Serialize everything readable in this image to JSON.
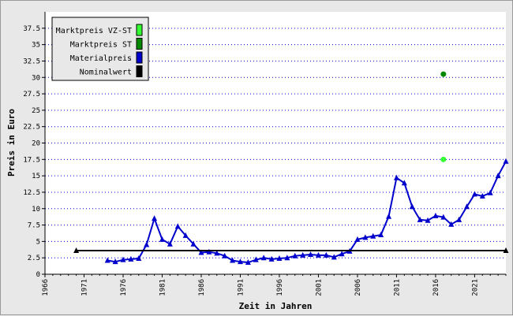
{
  "chart_data": {
    "type": "line",
    "title": "",
    "xlabel": "Zeit in Jahren",
    "ylabel": "Preis in Euro",
    "xlim": [
      1966,
      2025
    ],
    "ylim": [
      0,
      40
    ],
    "x_ticks": [
      "1966",
      "1971",
      "1976",
      "1981",
      "1986",
      "1991",
      "1996",
      "2001",
      "2006",
      "2011",
      "2016",
      "2021"
    ],
    "y_ticks": [
      "0",
      "2.5",
      "5",
      "7.5",
      "10",
      "12.5",
      "15",
      "17.5",
      "20",
      "22.5",
      "25",
      "27.5",
      "30",
      "32.5",
      "35",
      "37.5"
    ],
    "grid": "horizontal dotted",
    "legend_placement": "top-left",
    "legend": [
      {
        "name": "Marktpreis VZ-ST",
        "color": "#33ff33"
      },
      {
        "name": "Marktpreis ST",
        "color": "#008800"
      },
      {
        "name": "Materialpreis",
        "color": "#0000cc"
      },
      {
        "name": "Nominalwert",
        "color": "#000000"
      }
    ],
    "series": [
      {
        "name": "Materialpreis",
        "color": "#0000cc",
        "marker": "triangle",
        "x": [
          1974,
          1975,
          1976,
          1977,
          1978,
          1979,
          1980,
          1981,
          1982,
          1983,
          1984,
          1985,
          1986,
          1987,
          1988,
          1989,
          1990,
          1991,
          1992,
          1993,
          1994,
          1995,
          1996,
          1997,
          1998,
          1999,
          2000,
          2001,
          2002,
          2003,
          2004,
          2005,
          2006,
          2007,
          2008,
          2009,
          2010,
          2011,
          2012,
          2013,
          2014,
          2015,
          2016,
          2017,
          2018,
          2019,
          2020,
          2021,
          2022,
          2023,
          2024,
          2025
        ],
        "y": [
          2.1,
          1.9,
          2.2,
          2.3,
          2.4,
          4.5,
          8.5,
          5.3,
          4.6,
          7.3,
          5.9,
          4.6,
          3.3,
          3.4,
          3.2,
          2.8,
          2.1,
          1.9,
          1.8,
          2.2,
          2.5,
          2.3,
          2.4,
          2.5,
          2.8,
          2.9,
          3.0,
          2.9,
          2.9,
          2.6,
          3.1,
          3.5,
          5.3,
          5.6,
          5.8,
          6.0,
          8.8,
          14.7,
          13.9,
          10.3,
          8.3,
          8.2,
          8.9,
          8.7,
          7.6,
          8.3,
          10.3,
          12.2,
          11.9,
          12.4,
          15.0,
          17.2
        ]
      },
      {
        "name": "Nominalwert",
        "color": "#000000",
        "marker": "triangle-ends",
        "x": [
          1970,
          2025
        ],
        "y": [
          3.6,
          3.6
        ]
      },
      {
        "name": "Marktpreis ST",
        "color": "#008800",
        "marker": "dot",
        "x": [
          2017
        ],
        "y": [
          30.5
        ]
      },
      {
        "name": "Marktpreis VZ-ST",
        "color": "#33ff33",
        "marker": "dot",
        "x": [
          2017
        ],
        "y": [
          17.5
        ]
      }
    ]
  }
}
